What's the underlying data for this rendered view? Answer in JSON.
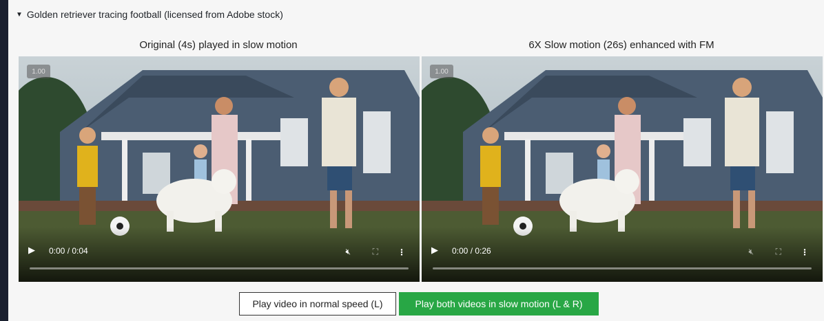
{
  "details": {
    "summary": "Golden retriever tracing football (licensed from Adobe stock)"
  },
  "videos": [
    {
      "title": "Original (4s) played in slow motion",
      "rate": "1.00",
      "time": "0:00 / 0:04",
      "progress_fraction": 0.0
    },
    {
      "title": "6X Slow motion (26s) enhanced with FM",
      "rate": "1.00",
      "time": "0:00 / 0:26",
      "progress_fraction": 0.0
    }
  ],
  "buttons": {
    "normal_speed": "Play video in normal speed (L)",
    "slow_motion": "Play both videos in slow motion (L & R)"
  },
  "colors": {
    "page_background": "#1b2130",
    "panel_background": "#f6f6f6",
    "primary_button": "#28a745"
  },
  "icons": {
    "play": "play-icon",
    "mute": "volume-muted-icon",
    "fullscreen": "fullscreen-icon",
    "more": "more-vertical-icon",
    "disclosure": "triangle-down-icon"
  }
}
